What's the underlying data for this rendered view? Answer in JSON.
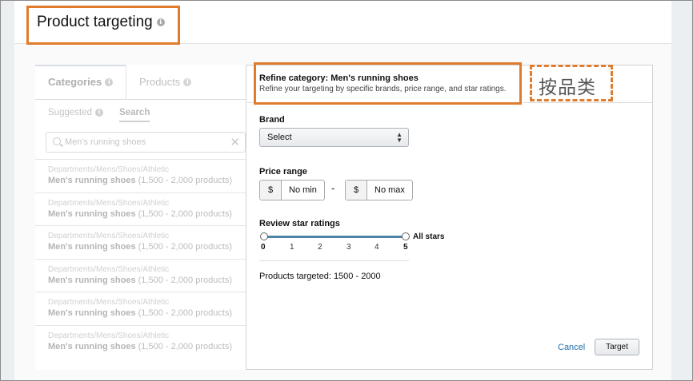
{
  "header": {
    "title": "Product targeting",
    "title_info_icon": "info-icon"
  },
  "left_panel": {
    "tabs": [
      {
        "label": "Categories"
      },
      {
        "label": "Products"
      }
    ],
    "subtabs": [
      {
        "label": "Suggested"
      },
      {
        "label": "Search"
      }
    ],
    "search": {
      "value": "Men's running shoes"
    },
    "results": [
      {
        "path": "Departments/Mens/Shoes/Athletic",
        "name": "Men's running shoes",
        "count": "(1,500 - 2,000 products)"
      },
      {
        "path": "Departments/Mens/Shoes/Athletic",
        "name": "Men's running shoes",
        "count": "(1,500 - 2,000 products)"
      },
      {
        "path": "Departments/Mens/Shoes/Athletic",
        "name": "Men's running shoes",
        "count": "(1,500 - 2,000 products)"
      },
      {
        "path": "Departments/Mens/Shoes/Athletic",
        "name": "Men's running shoes",
        "count": "(1,500 - 2,000 products)"
      },
      {
        "path": "Departments/Mens/Shoes/Athletic",
        "name": "Men's running shoes",
        "count": "(1,500 - 2,000 products)"
      },
      {
        "path": "Departments/Mens/Shoes/Athletic",
        "name": "Men's running shoes",
        "count": "(1,500 - 2,000 products)"
      }
    ]
  },
  "refine": {
    "title": "Refine category: Men's running shoes",
    "subtitle": "Refine your targeting by specific brands, price range, and star ratings.",
    "annotation": "按品类",
    "brand": {
      "label": "Brand",
      "selected": "Select"
    },
    "price": {
      "label": "Price range",
      "currency": "$",
      "min": "No min",
      "separator": "-",
      "max": "No max"
    },
    "rating": {
      "label": "Review star ratings",
      "value_label": "All stars",
      "ticks": [
        "0",
        "1",
        "2",
        "3",
        "4",
        "5"
      ],
      "min": 0,
      "max": 5
    },
    "products_targeted": "Products targeted: 1500 - 2000",
    "cancel_label": "Cancel",
    "target_label": "Target"
  },
  "colors": {
    "annotation_orange": "#e07c2d",
    "slider_blue": "#4e83a6",
    "link_blue": "#1f6fa8"
  }
}
